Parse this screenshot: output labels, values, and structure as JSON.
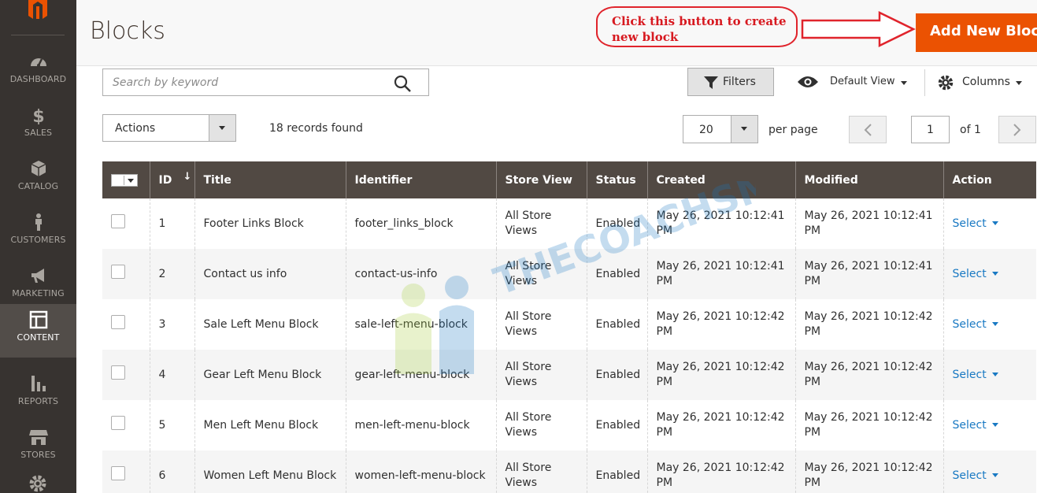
{
  "sidebar": {
    "items": [
      {
        "label": "DASHBOARD",
        "icon": "dashboard-icon"
      },
      {
        "label": "SALES",
        "icon": "dollar-icon"
      },
      {
        "label": "CATALOG",
        "icon": "cube-icon"
      },
      {
        "label": "CUSTOMERS",
        "icon": "person-icon"
      },
      {
        "label": "MARKETING",
        "icon": "megaphone-icon"
      },
      {
        "label": "CONTENT",
        "icon": "layout-icon"
      },
      {
        "label": "REPORTS",
        "icon": "bar-chart-icon"
      },
      {
        "label": "STORES",
        "icon": "store-icon"
      }
    ],
    "active": "CONTENT"
  },
  "header": {
    "title": "Blocks",
    "callout": "Click this button to create new block",
    "add_button": "Add New Block"
  },
  "toolbar": {
    "search_placeholder": "Search by keyword",
    "filters": "Filters",
    "view": "Default View",
    "columns": "Columns",
    "actions": "Actions",
    "records": "18 records found",
    "per_page_value": "20",
    "per_page_label": "per page",
    "page": "1",
    "of": "of 1"
  },
  "table": {
    "headers": [
      "ID",
      "Title",
      "Identifier",
      "Store View",
      "Status",
      "Created",
      "Modified",
      "Action"
    ],
    "rows": [
      {
        "id": "1",
        "title": "Footer Links Block",
        "identifier": "footer_links_block",
        "store_view": "All Store Views",
        "status": "Enabled",
        "created": "May 26, 2021 10:12:41 PM",
        "modified": "May 26, 2021 10:12:41 PM",
        "action": "Select"
      },
      {
        "id": "2",
        "title": "Contact us info",
        "identifier": "contact-us-info",
        "store_view": "All Store Views",
        "status": "Enabled",
        "created": "May 26, 2021 10:12:41 PM",
        "modified": "May 26, 2021 10:12:41 PM",
        "action": "Select"
      },
      {
        "id": "3",
        "title": "Sale Left Menu Block",
        "identifier": "sale-left-menu-block",
        "store_view": "All Store Views",
        "status": "Enabled",
        "created": "May 26, 2021 10:12:42 PM",
        "modified": "May 26, 2021 10:12:42 PM",
        "action": "Select"
      },
      {
        "id": "4",
        "title": "Gear Left Menu Block",
        "identifier": "gear-left-menu-block",
        "store_view": "All Store Views",
        "status": "Enabled",
        "created": "May 26, 2021 10:12:42 PM",
        "modified": "May 26, 2021 10:12:42 PM",
        "action": "Select"
      },
      {
        "id": "5",
        "title": "Men Left Menu Block",
        "identifier": "men-left-menu-block",
        "store_view": "All Store Views",
        "status": "Enabled",
        "created": "May 26, 2021 10:12:42 PM",
        "modified": "May 26, 2021 10:12:42 PM",
        "action": "Select"
      },
      {
        "id": "6",
        "title": "Women Left Menu Block",
        "identifier": "women-left-menu-block",
        "store_view": "All Store Views",
        "status": "Enabled",
        "created": "May 26, 2021 10:12:42 PM",
        "modified": "May 26, 2021 10:12:42 PM",
        "action": "Select"
      }
    ]
  },
  "watermark": "THECOACHSMB",
  "colors": {
    "sidebar": "#373330",
    "accent": "#eb5202",
    "table_header": "#514943",
    "link": "#1979c3",
    "callout": "#d71920"
  }
}
